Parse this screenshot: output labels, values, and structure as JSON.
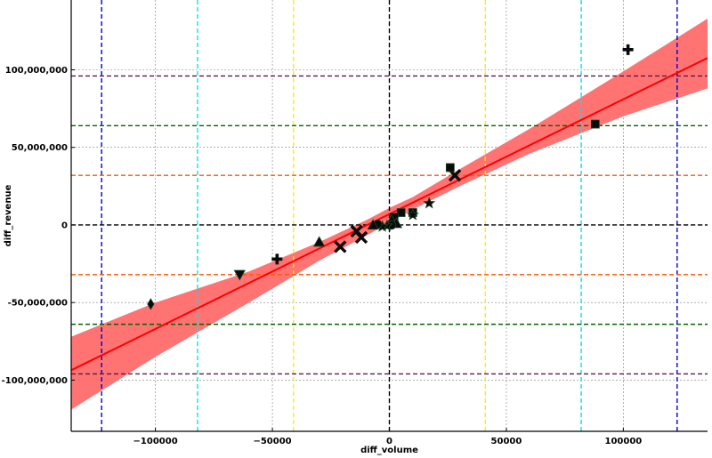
{
  "chart_data": {
    "type": "scatter",
    "title": "",
    "xlabel": "diff_volume",
    "ylabel": "diff_revenue",
    "xlim": [
      -136000,
      136000
    ],
    "ylim": [
      -133000000,
      145000000
    ],
    "x_ticks": [
      -100000,
      -50000,
      0,
      50000,
      100000
    ],
    "x_tick_labels": [
      "−100000",
      "−50000",
      "0",
      "50000",
      "100000"
    ],
    "y_ticks": [
      -100000000,
      -50000000,
      0,
      50000000,
      100000000
    ],
    "y_tick_labels": [
      "-100,000,000",
      "-50,000,000",
      "0",
      "50,000,000",
      "100,000,000"
    ],
    "grid": true,
    "grid_color": "#808080",
    "regression": {
      "x_range": [
        -136000,
        136000
      ],
      "slope": 740,
      "intercept": 7000000,
      "line_color": "#ff0000",
      "band_color": "#ff6b6b",
      "band": {
        "x": [
          -136000,
          -100000,
          -60000,
          -30000,
          -10000,
          0,
          10000,
          30000,
          60000,
          100000,
          136000
        ],
        "lower": [
          -119000000,
          -85000000,
          -50000000,
          -23000000,
          -7000000,
          1500000,
          10000000,
          25000000,
          46000000,
          70000000,
          88000000
        ],
        "upper": [
          -72000000,
          -50000000,
          -30000000,
          -11000000,
          3000000,
          11000000,
          18000000,
          36000000,
          62000000,
          99000000,
          133000000
        ]
      }
    },
    "reference_lines": {
      "vertical": [
        {
          "x": -123000,
          "color": "#0000cc"
        },
        {
          "x": 123000,
          "color": "#0000cc"
        },
        {
          "x": -82000,
          "color": "#00e5ee"
        },
        {
          "x": 82000,
          "color": "#00e5ee"
        },
        {
          "x": -41000,
          "color": "#ffee00"
        },
        {
          "x": 41000,
          "color": "#ffee00"
        },
        {
          "x": 0,
          "color": "#000000"
        }
      ],
      "horizontal": [
        {
          "y": 96000000,
          "color": "#5a1a4a"
        },
        {
          "y": -96000000,
          "color": "#5a1a4a"
        },
        {
          "y": 64000000,
          "color": "#006400"
        },
        {
          "y": -64000000,
          "color": "#006400"
        },
        {
          "y": 32000000,
          "color": "#ff5500"
        },
        {
          "y": -32000000,
          "color": "#ff5500"
        },
        {
          "y": 0,
          "color": "#000000"
        }
      ]
    },
    "points": [
      {
        "x": 102000,
        "y": 113000000,
        "marker": "plus"
      },
      {
        "x": 88000,
        "y": 65000000,
        "marker": "square"
      },
      {
        "x": 28000,
        "y": 32000000,
        "marker": "x"
      },
      {
        "x": 26000,
        "y": 37000000,
        "marker": "square"
      },
      {
        "x": 17000,
        "y": 14000000,
        "marker": "star"
      },
      {
        "x": 10000,
        "y": 8000000,
        "marker": "square"
      },
      {
        "x": 10000,
        "y": 6500000,
        "marker": "star"
      },
      {
        "x": 5000,
        "y": 8000000,
        "marker": "square"
      },
      {
        "x": 2000,
        "y": 5000000,
        "marker": "square"
      },
      {
        "x": 1000,
        "y": 3000000,
        "marker": "triangle-up"
      },
      {
        "x": 3000,
        "y": 1000000,
        "marker": "triangle-up"
      },
      {
        "x": 1000,
        "y": 0,
        "marker": "circle"
      },
      {
        "x": -1000,
        "y": -500000,
        "marker": "star"
      },
      {
        "x": -3000,
        "y": -1000000,
        "marker": "star"
      },
      {
        "x": -5000,
        "y": 500000,
        "marker": "circle"
      },
      {
        "x": -7000,
        "y": 0,
        "marker": "triangle-up"
      },
      {
        "x": -12000,
        "y": -8000000,
        "marker": "x"
      },
      {
        "x": -14000,
        "y": -4000000,
        "marker": "x"
      },
      {
        "x": -21000,
        "y": -14000000,
        "marker": "x"
      },
      {
        "x": -30000,
        "y": -11000000,
        "marker": "triangle-up"
      },
      {
        "x": -48000,
        "y": -22000000,
        "marker": "plus"
      },
      {
        "x": -64000,
        "y": -32000000,
        "marker": "triangle-down"
      },
      {
        "x": -102000,
        "y": -51000000,
        "marker": "diamond"
      }
    ]
  }
}
